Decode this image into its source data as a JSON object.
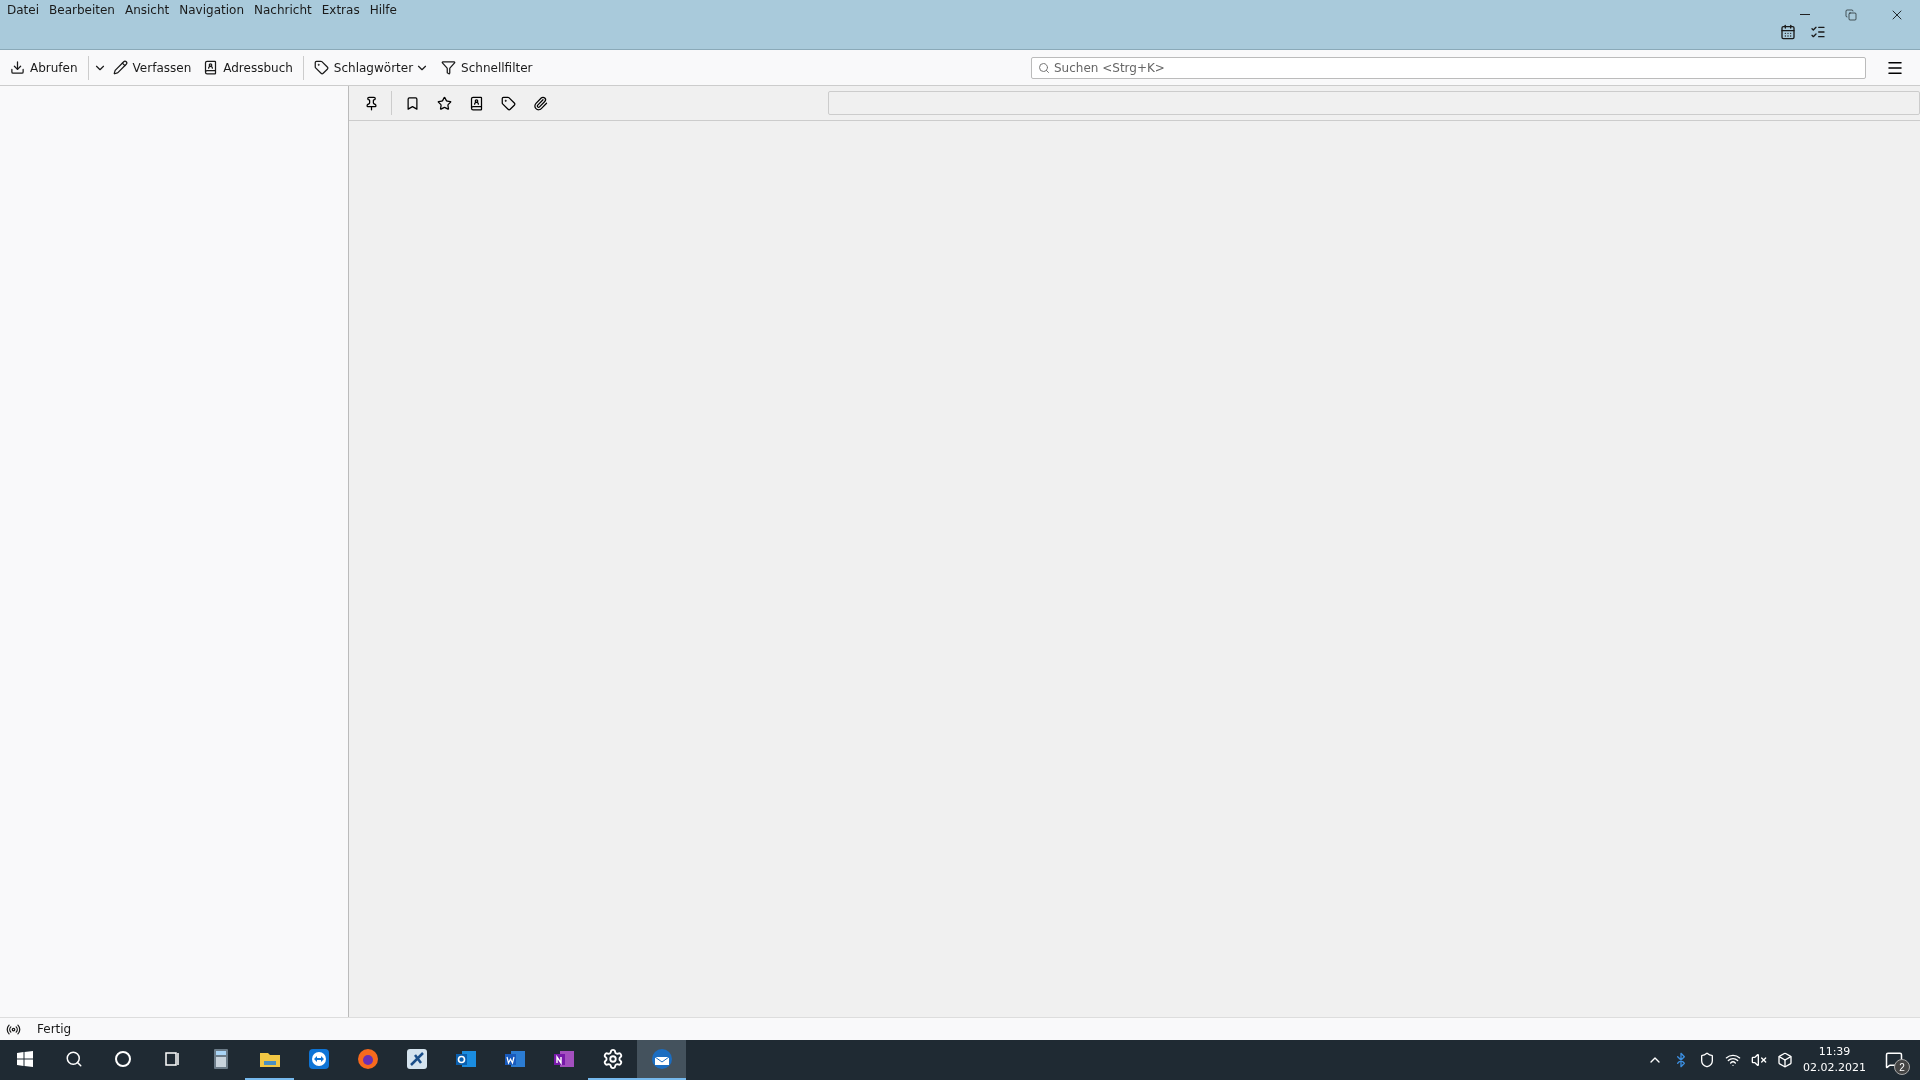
{
  "menu_bar": [
    "Datei",
    "Bearbeiten",
    "Ansicht",
    "Navigation",
    "Nachricht",
    "Extras",
    "Hilfe"
  ],
  "toolbar": {
    "buttons": [
      {
        "kind": "get",
        "label": "Abrufen"
      },
      {
        "kind": "compose",
        "label": "Verfassen"
      },
      {
        "kind": "addressbook",
        "label": "Adressbuch"
      },
      {
        "kind": "tags",
        "label": "Schlagwörter"
      },
      {
        "kind": "filter",
        "label": "Schnellfilter"
      }
    ],
    "search": {
      "placeholder": "Suchen <Strg+K>"
    }
  },
  "quick_filter": {
    "buttons": [
      {
        "kind": "pin",
        "on": false
      },
      {
        "kind": "unread",
        "on": false
      },
      {
        "kind": "star",
        "on": false
      },
      {
        "kind": "contact",
        "on": false
      },
      {
        "kind": "tag",
        "on": false
      },
      {
        "kind": "attachment",
        "on": false
      }
    ]
  },
  "status_bar": {
    "text": "Fertig"
  },
  "taskbar": {
    "apps": [
      {
        "kind": "calculator",
        "running": false,
        "selected": false
      },
      {
        "kind": "folder",
        "running": true,
        "selected": false
      },
      {
        "kind": "remote",
        "running": false,
        "selected": false
      },
      {
        "kind": "browser",
        "running": false,
        "selected": false
      },
      {
        "kind": "tool",
        "running": false,
        "selected": false
      },
      {
        "kind": "outlook",
        "running": false,
        "selected": false
      },
      {
        "kind": "word",
        "running": false,
        "selected": false
      },
      {
        "kind": "onenote",
        "running": false,
        "selected": false
      },
      {
        "kind": "gear",
        "running": true,
        "selected": false
      },
      {
        "kind": "mail",
        "running": true,
        "selected": true
      }
    ],
    "time": "11:39",
    "date": "02.02.2021",
    "notifications": "2"
  }
}
